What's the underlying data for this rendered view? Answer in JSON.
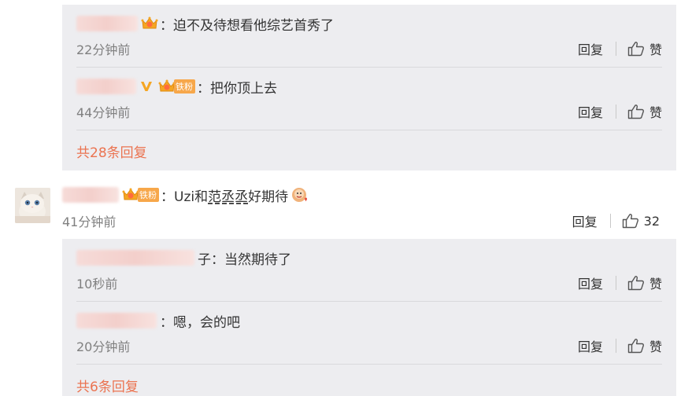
{
  "actions": {
    "reply_label": "回复",
    "like_label": "赞"
  },
  "thread1": {
    "replies": [
      {
        "text": "：迫不及待想看他综艺首秀了",
        "time": "22分钟前"
      },
      {
        "badge": "铁粉",
        "text": "：把你顶上去",
        "time": "44分钟前"
      }
    ],
    "more": "共28条回复"
  },
  "comment": {
    "badge": "铁粉",
    "text_before": "：Uzi和",
    "mention": "范丞丞",
    "text_after": "好期待",
    "time": "41分钟前",
    "like_count": "32",
    "replies": [
      {
        "name_tail": "子",
        "text": "：当然期待了",
        "time": "10秒前"
      },
      {
        "text": "：嗯，会的吧",
        "time": "20分钟前"
      }
    ],
    "more": "共6条回复"
  },
  "colors": {
    "sub_background": "#ededf0",
    "link": "#eb7350",
    "badge": "#f7a74a",
    "time": "#808080"
  },
  "icons": [
    "crown-badge-icon",
    "verified-v-icon",
    "thumbs-up-icon",
    "emoji-sticker-icon"
  ]
}
